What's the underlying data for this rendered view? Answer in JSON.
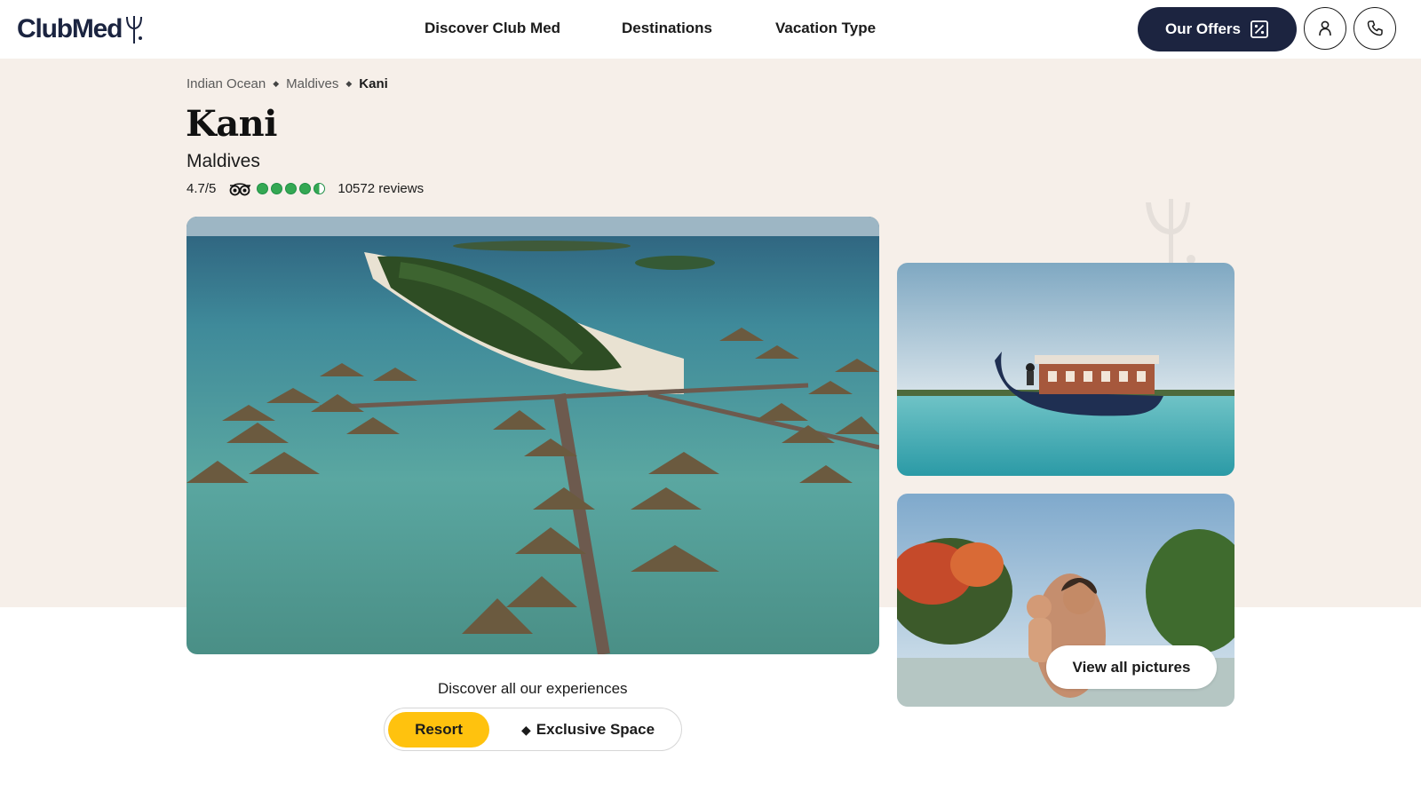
{
  "header": {
    "logo_text": "ClubMed",
    "nav": [
      {
        "label": "Discover Club Med"
      },
      {
        "label": "Destinations"
      },
      {
        "label": "Vacation Type"
      }
    ],
    "offers_label": "Our Offers",
    "icons": {
      "offers": "percent-tag-icon",
      "account": "user-icon",
      "phone": "phone-icon"
    }
  },
  "breadcrumb": [
    {
      "label": "Indian Ocean"
    },
    {
      "label": "Maldives"
    },
    {
      "label": "Kani"
    }
  ],
  "resort": {
    "name": "Kani",
    "location": "Maldives",
    "rating": "4.7/5",
    "rating_value": 4.7,
    "rating_max": 5,
    "reviews": "10572 reviews"
  },
  "gallery": {
    "view_all_label": "View all pictures"
  },
  "experiences": {
    "label": "Discover all our experiences",
    "options": [
      {
        "label": "Resort",
        "selected": true
      },
      {
        "label": "Exclusive Space",
        "selected": false
      }
    ]
  },
  "colors": {
    "navy": "#1c2440",
    "accent_yellow": "#ffc20e",
    "beige": "#f6efe9",
    "rating_green": "#34a853"
  }
}
